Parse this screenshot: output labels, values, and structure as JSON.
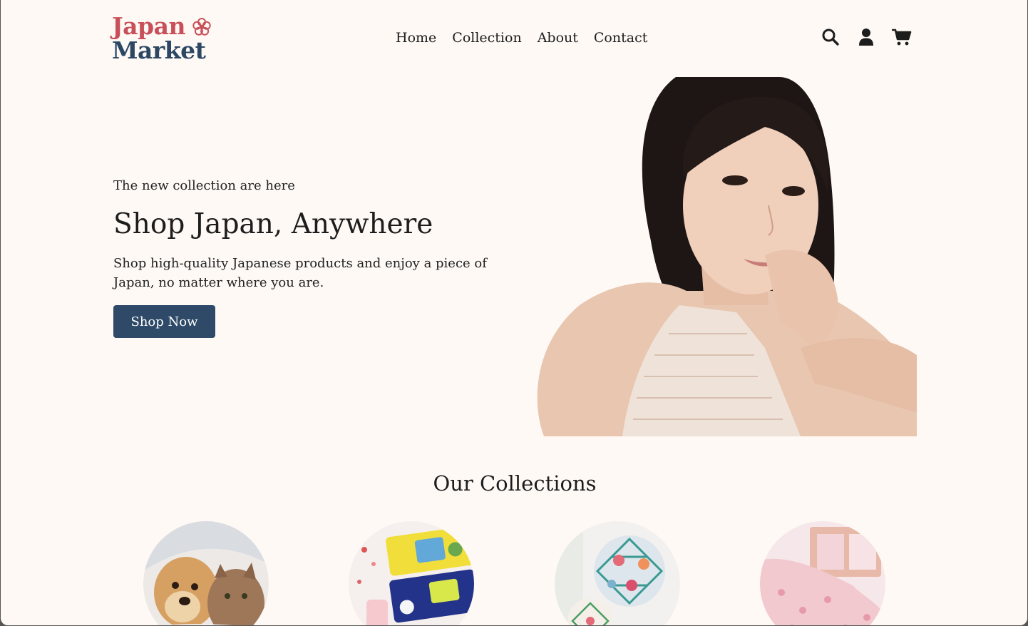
{
  "header": {
    "logo_line1": "Japan",
    "logo_line2": "Market",
    "nav": [
      "Home",
      "Collection",
      "About",
      "Contact"
    ],
    "icons": [
      "search-icon",
      "user-icon",
      "cart-icon"
    ]
  },
  "hero": {
    "eyebrow": "The new collection are here",
    "title": "Shop Japan, Anywhere",
    "description": "Shop high-quality Japanese products and enjoy a piece of Japan, no matter where you are.",
    "cta_label": "Shop Now"
  },
  "collections": {
    "title": "Our Collections",
    "items": [
      "pets",
      "beauty-face-masks",
      "temari-balls",
      "sakura-towels"
    ]
  },
  "colors": {
    "background": "#fef9f5",
    "brand_red": "#c8505a",
    "brand_navy": "#2b4763",
    "button": "#2e4a68"
  }
}
